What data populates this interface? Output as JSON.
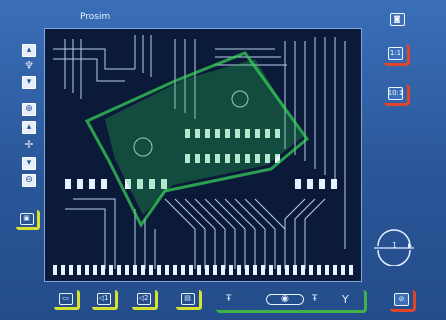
{
  "window": {
    "title": "Prosim"
  },
  "left_toolbar": {
    "items": [
      {
        "name": "scroll-up-button",
        "glyph": "▴"
      },
      {
        "name": "pin-icon",
        "glyph": "♆"
      },
      {
        "name": "scroll-down-button",
        "glyph": "▾"
      },
      {
        "name": "zoom-in-button",
        "glyph": "⊕"
      },
      {
        "name": "pan-up-button",
        "glyph": "▴"
      },
      {
        "name": "center-icon",
        "glyph": "✛"
      },
      {
        "name": "pan-down-button",
        "glyph": "▾"
      },
      {
        "name": "zoom-out-button",
        "glyph": "⊖"
      }
    ],
    "open_button": "▣"
  },
  "right_toolbar": {
    "top_glyph": "◙",
    "zoom_1": "1:1",
    "zoom_10": "10:1",
    "stop_glyph": "⊘"
  },
  "bottom_toolbar": {
    "b1": "▭",
    "b2": "◁1",
    "b3": "◁2",
    "b4": "▤",
    "mode_left": "Ŧ",
    "mode_center": "◉",
    "mode_right": "Ŧ",
    "mode_far": "Y"
  },
  "rotation": {
    "label": "1"
  },
  "colors": {
    "accent_yellow": "#d8e22e",
    "accent_red": "#e0452a",
    "accent_green": "#3fb24a",
    "frame": "#2a5698"
  }
}
